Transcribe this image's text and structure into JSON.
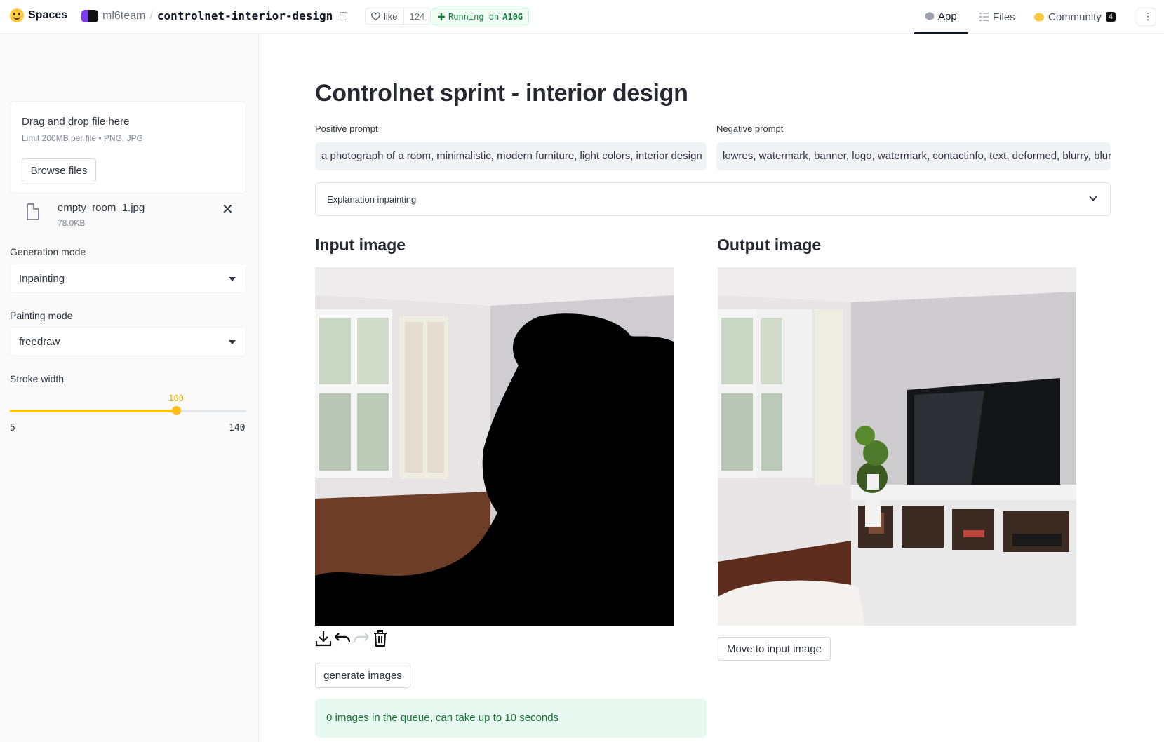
{
  "header": {
    "brand": "Spaces",
    "team": "ml6team",
    "separator": "/",
    "repo": "controlnet-interior-design",
    "like_label": "like",
    "like_count": "124",
    "running_prefix": "Running on",
    "running_hw": "A10G",
    "tabs": [
      {
        "label": "App",
        "icon": "cube-icon",
        "active": true
      },
      {
        "label": "Files",
        "icon": "files-icon",
        "active": false
      },
      {
        "label": "Community",
        "icon": "community-icon",
        "active": false,
        "badge": "4"
      }
    ]
  },
  "sidebar": {
    "uploader": {
      "title": "Drag and drop file here",
      "limit": "Limit 200MB per file • PNG, JPG",
      "browse_label": "Browse files"
    },
    "file": {
      "name": "empty_room_1.jpg",
      "size": "78.0KB"
    },
    "generation_mode": {
      "label": "Generation mode",
      "value": "Inpainting"
    },
    "painting_mode": {
      "label": "Painting mode",
      "value": "freedraw"
    },
    "stroke_width": {
      "label": "Stroke width",
      "value": 100,
      "value_text": "100",
      "min": 5,
      "min_text": "5",
      "max": 140,
      "max_text": "140"
    }
  },
  "main": {
    "title": "Controlnet sprint - interior design",
    "positive_prompt": {
      "label": "Positive prompt",
      "value": "a photograph of a room, minimalistic, modern furniture, light colors, interior design"
    },
    "negative_prompt": {
      "label": "Negative prompt",
      "value": "lowres, watermark, banner, logo, watermark, contactinfo, text, deformed, blurry, blur"
    },
    "expander_label": "Explanation inpainting",
    "input_heading": "Input image",
    "output_heading": "Output image",
    "canvas_tools": [
      "download-icon",
      "undo-icon",
      "redo-icon",
      "trash-icon"
    ],
    "generate_label": "generate images",
    "move_label": "Move to input image",
    "status_text": "0 images in the queue, can take up to 10 seconds"
  },
  "colors": {
    "accent": "#ffbd1a",
    "status_bg": "#e8f9f1",
    "status_text": "#177233",
    "running": "#15803d"
  }
}
